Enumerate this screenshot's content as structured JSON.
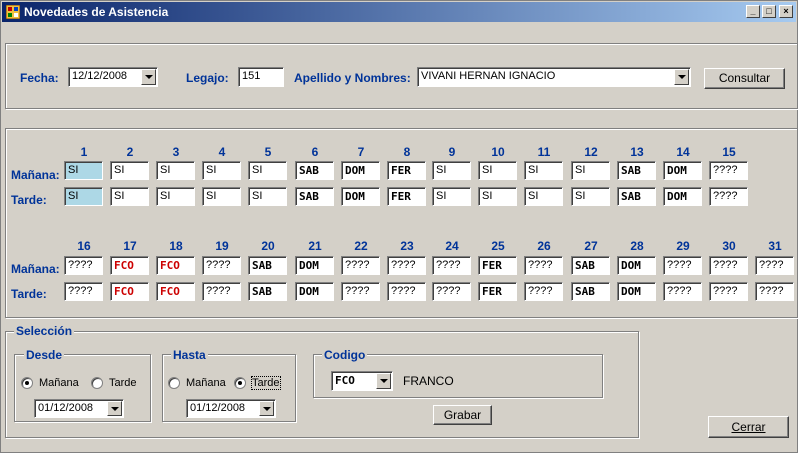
{
  "window": {
    "title": "Novedades de Asistencia"
  },
  "header": {
    "fecha_label": "Fecha:",
    "fecha_value": "12/12/2008",
    "legajo_label": "Legajo:",
    "legajo_value": "151",
    "apellido_label": "Apellido y Nombres:",
    "apellido_value": "VIVANI HERNAN IGNACIO",
    "consultar_label": "Consultar"
  },
  "grid": {
    "manana_label": "Mañana:",
    "tarde_label": "Tarde:",
    "days_1_15": [
      "1",
      "2",
      "3",
      "4",
      "5",
      "6",
      "7",
      "8",
      "9",
      "10",
      "11",
      "12",
      "13",
      "14",
      "15"
    ],
    "manana_1_15": [
      "SI",
      "SI",
      "SI",
      "SI",
      "SI",
      "SAB",
      "DOM",
      "FER",
      "SI",
      "SI",
      "SI",
      "SI",
      "SAB",
      "DOM",
      "????"
    ],
    "tarde_1_15": [
      "SI",
      "SI",
      "SI",
      "SI",
      "SI",
      "SAB",
      "DOM",
      "FER",
      "SI",
      "SI",
      "SI",
      "SI",
      "SAB",
      "DOM",
      "????"
    ],
    "days_16_31": [
      "16",
      "17",
      "18",
      "19",
      "20",
      "21",
      "22",
      "23",
      "24",
      "25",
      "26",
      "27",
      "28",
      "29",
      "30",
      "31"
    ],
    "manana_16_31": [
      "????",
      "FCO",
      "FCO",
      "????",
      "SAB",
      "DOM",
      "????",
      "????",
      "????",
      "FER",
      "????",
      "SAB",
      "DOM",
      "????",
      "????",
      "????"
    ],
    "tarde_16_31": [
      "????",
      "FCO",
      "FCO",
      "????",
      "SAB",
      "DOM",
      "????",
      "????",
      "????",
      "FER",
      "????",
      "SAB",
      "DOM",
      "????",
      "????",
      "????"
    ]
  },
  "seleccion": {
    "title": "Selección",
    "desde": {
      "title": "Desde",
      "manana": "Mañana",
      "tarde": "Tarde",
      "date": "01/12/2008"
    },
    "hasta": {
      "title": "Hasta",
      "manana": "Mañana",
      "tarde": "Tarde",
      "date": "01/12/2008"
    },
    "codigo": {
      "title": "Codigo",
      "value": "FCO",
      "description": "FRANCO"
    },
    "grabar_label": "Grabar"
  },
  "cerrar_label": "Cerrar"
}
